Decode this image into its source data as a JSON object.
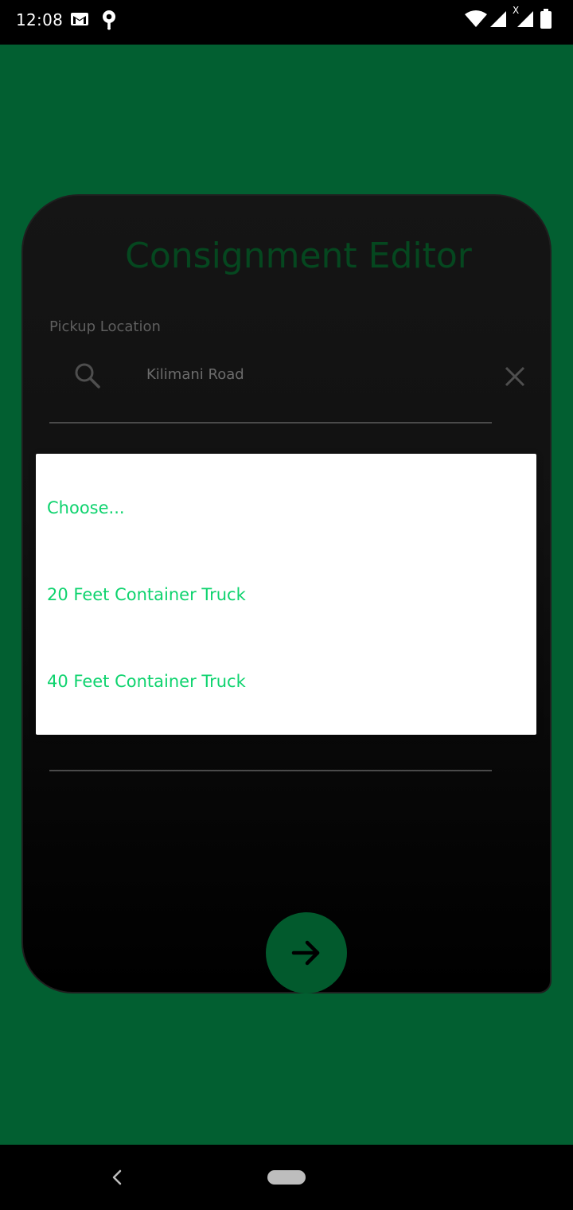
{
  "status_bar": {
    "time": "12:08",
    "icons": [
      "gmail-icon",
      "location-pin-icon",
      "wifi-icon",
      "signal-icon",
      "signal-no-data-icon",
      "battery-icon"
    ]
  },
  "editor": {
    "title": "Consignment Editor",
    "pickup_label": "Pickup Location",
    "pickup_value": "Kilimani Road",
    "title_color": "#05471f"
  },
  "dropdown": {
    "options": [
      {
        "label": "Choose..."
      },
      {
        "label": "20 Feet Container Truck"
      },
      {
        "label": "40 Feet Container Truck"
      }
    ],
    "text_color": "#0ed36e"
  },
  "colors": {
    "background": "#025f31",
    "card": "#151515",
    "fab": "#025a2d"
  }
}
